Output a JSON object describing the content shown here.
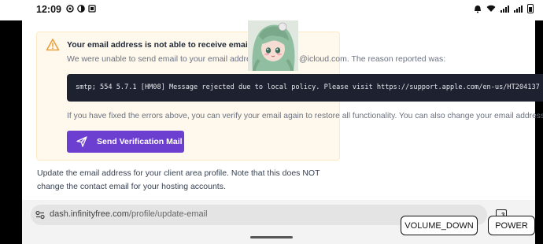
{
  "status_bar": {
    "time": "12:09"
  },
  "alert": {
    "title": "Your email address is not able to receive email.",
    "description_part1": "We were unable to send email to your email address",
    "description_part2": "@icloud.com. The reason reported was:",
    "error_code": "smtp; 554 5.7.1 [HM08] Message rejected due to local policy. Please visit https://support.apple.com/en-us/HT204137",
    "fix_text": "If you have fixed the errors above, you can verify your email again to restore all functionality. You can also change your email address.",
    "send_button_label": "Send Verification Mail"
  },
  "update_text": "Update the email address for your client area profile. Note that this does NOT change the contact email for your hosting accounts.",
  "browser": {
    "url_host": "dash.infinityfree.com",
    "url_path": "/profile/update-email",
    "tab_count": "3"
  },
  "hardware_buttons": {
    "volume_down": "VOLUME_DOWN",
    "power": "POWER"
  },
  "colors": {
    "accent": "#6d3fd1",
    "alert_bg": "#fff8ec",
    "warning": "#e6a23c",
    "code_bg": "#1e2130"
  }
}
